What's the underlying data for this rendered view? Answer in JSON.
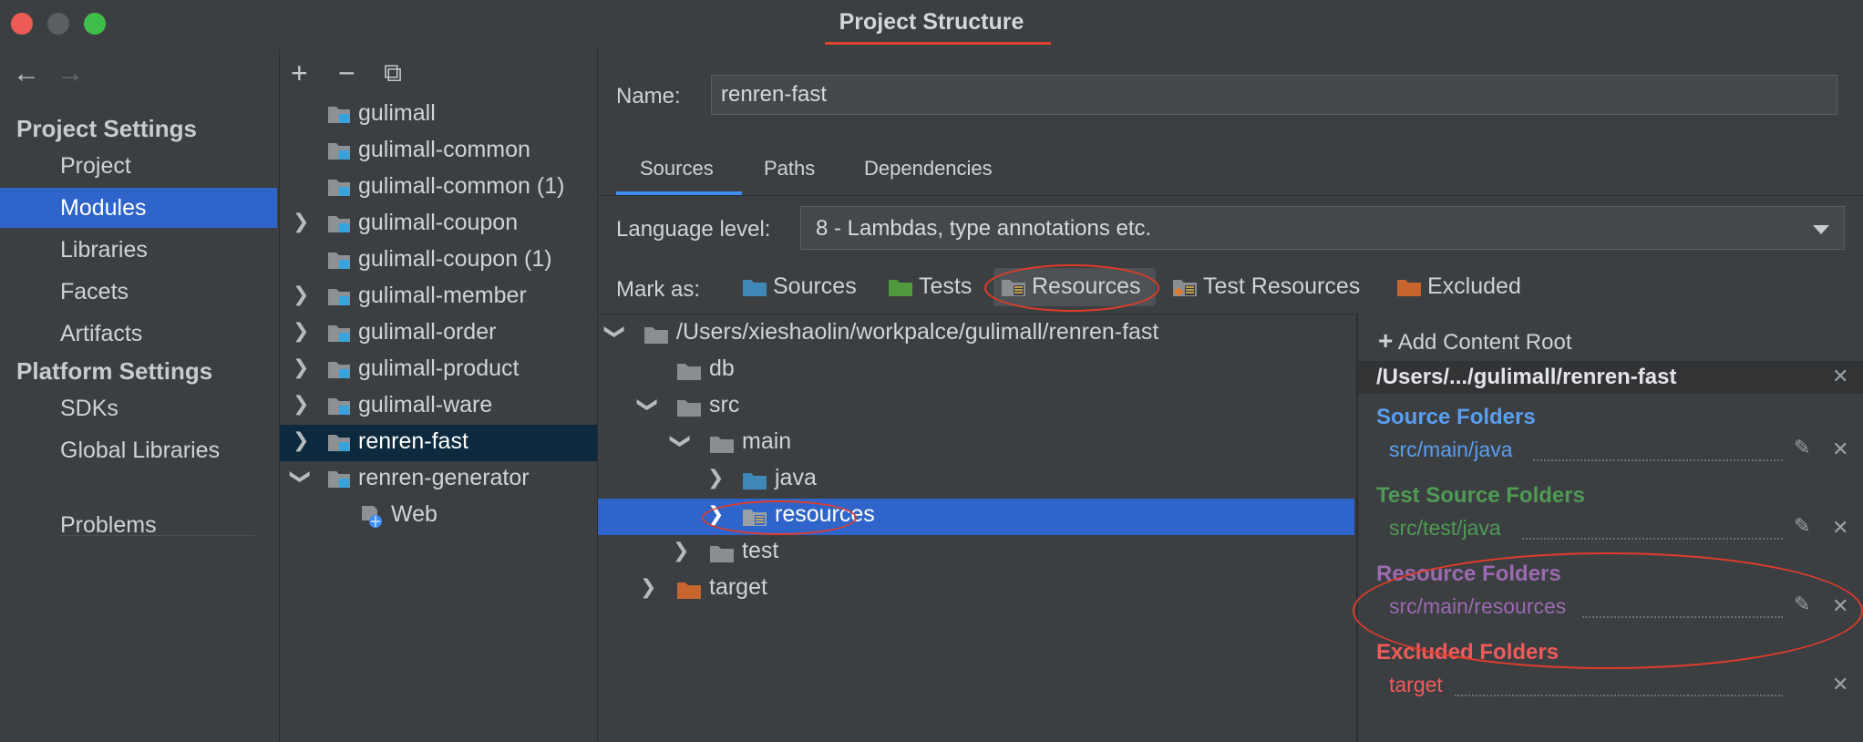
{
  "window": {
    "title": "Project Structure"
  },
  "nav": {
    "project_settings_header": "Project Settings",
    "platform_settings_header": "Platform Settings",
    "items": [
      {
        "label": "Project"
      },
      {
        "label": "Modules"
      },
      {
        "label": "Libraries"
      },
      {
        "label": "Facets"
      },
      {
        "label": "Artifacts"
      },
      {
        "label": "SDKs"
      },
      {
        "label": "Global Libraries"
      },
      {
        "label": "Problems"
      }
    ],
    "selected": "Modules"
  },
  "modules": {
    "toolbar": {
      "add": "+",
      "remove": "−",
      "copy": "⧉"
    },
    "items": [
      {
        "label": "gulimall"
      },
      {
        "label": "gulimall-common"
      },
      {
        "label": "gulimall-common (1)"
      },
      {
        "label": "gulimall-coupon"
      },
      {
        "label": "gulimall-coupon (1)"
      },
      {
        "label": "gulimall-member"
      },
      {
        "label": "gulimall-order"
      },
      {
        "label": "gulimall-product"
      },
      {
        "label": "gulimall-ware"
      },
      {
        "label": "renren-fast"
      },
      {
        "label": "renren-generator"
      },
      {
        "label": "Web"
      }
    ],
    "selected": "renren-fast"
  },
  "main": {
    "name_label": "Name:",
    "name_value": "renren-fast",
    "tabs": [
      {
        "label": "Sources"
      },
      {
        "label": "Paths"
      },
      {
        "label": "Dependencies"
      }
    ],
    "active_tab": "Sources",
    "language_level_label": "Language level:",
    "language_level_value": "8 - Lambdas, type annotations etc.",
    "mark_as_label": "Mark as:",
    "mark_as": [
      {
        "label": "Sources",
        "color": "#3e88b8"
      },
      {
        "label": "Tests",
        "color": "#4f9a3d"
      },
      {
        "label": "Resources",
        "color": "#8a8d91"
      },
      {
        "label": "Test Resources",
        "color": "#8a8d91"
      },
      {
        "label": "Excluded",
        "color": "#c8652e"
      }
    ]
  },
  "tree": {
    "root_path": "/Users/xieshaolin/workpalce/gulimall/renren-fast",
    "nodes": [
      {
        "label": "db"
      },
      {
        "label": "src"
      },
      {
        "label": "main"
      },
      {
        "label": "java"
      },
      {
        "label": "resources"
      },
      {
        "label": "test"
      },
      {
        "label": "target"
      }
    ],
    "selected": "resources"
  },
  "content_roots": {
    "add_label": "Add Content Root",
    "root": "/Users/.../gulimall/renren-fast",
    "groups": [
      {
        "header": "Source Folders",
        "path": "src/main/java",
        "color": "#5a9ef0"
      },
      {
        "header": "Test Source Folders",
        "path": "src/test/java",
        "color": "#4f9a55"
      },
      {
        "header": "Resource Folders",
        "path": "src/main/resources",
        "color": "#9a6bb0"
      },
      {
        "header": "Excluded Folders",
        "path": "target",
        "color": "#f05a5a"
      }
    ]
  },
  "colors": {
    "selection": "#2f65ca",
    "annotation": "#e23b2a"
  }
}
